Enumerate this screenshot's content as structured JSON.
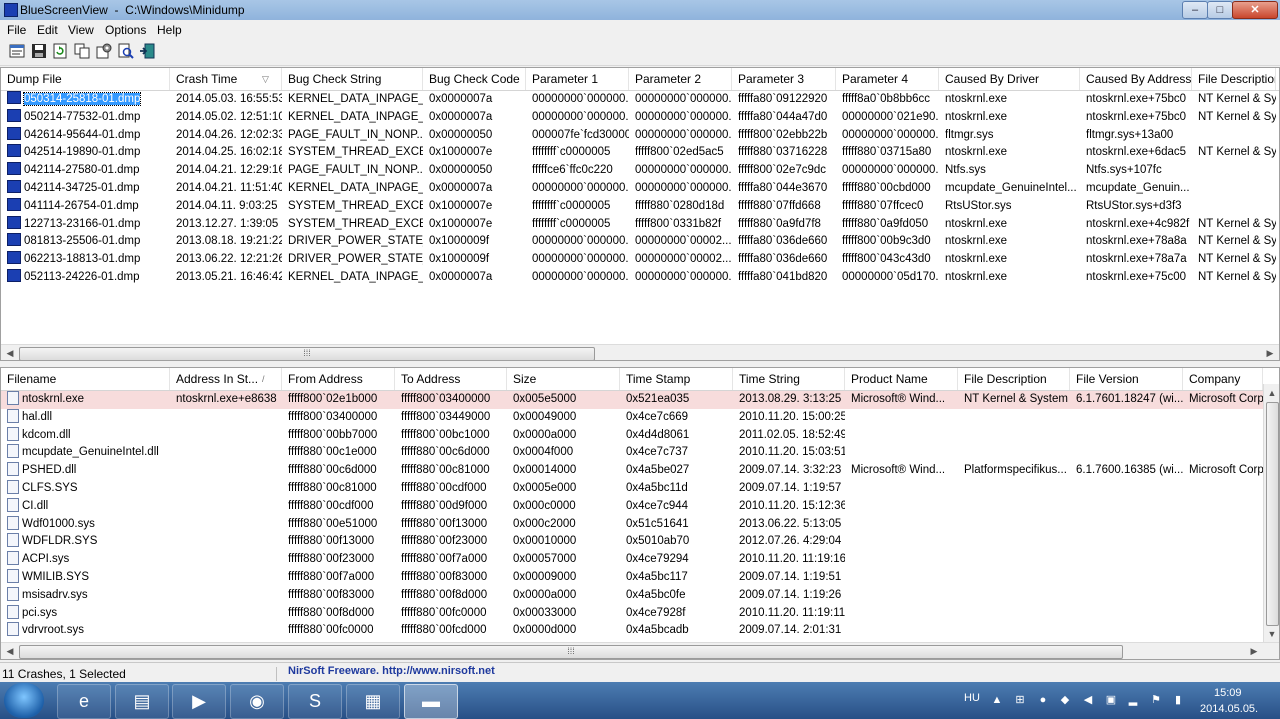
{
  "window": {
    "title": "BlueScreenView  -  C:\\Windows\\Minidump",
    "minimize": "–",
    "maximize": "□",
    "close": "✕"
  },
  "menu": [
    "File",
    "Edit",
    "View",
    "Options",
    "Help"
  ],
  "toolbar_icons": [
    "properties-icon",
    "save-icon",
    "refresh-icon",
    "copy-icon",
    "advanced-options-icon",
    "find-icon",
    "exit-icon"
  ],
  "dumps": {
    "columns": [
      "Dump File",
      "Crash Time",
      "Bug Check String",
      "Bug Check Code",
      "Parameter 1",
      "Parameter 2",
      "Parameter 3",
      "Parameter 4",
      "Caused By Driver",
      "Caused By Address",
      "File Description"
    ],
    "sort_indicator": "▽",
    "rows": [
      [
        "050314-25818-01.dmp",
        "2014.05.03. 16:55:53",
        "KERNEL_DATA_INPAGE_...",
        "0x0000007a",
        "00000000`000000...",
        "00000000`000000...",
        "fffffa80`09122920",
        "fffff8a0`0b8bb6cc",
        "ntoskrnl.exe",
        "ntoskrnl.exe+75bc0",
        "NT Kernel & Syst"
      ],
      [
        "050214-77532-01.dmp",
        "2014.05.02. 12:51:10",
        "KERNEL_DATA_INPAGE_...",
        "0x0000007a",
        "00000000`000000...",
        "00000000`000000...",
        "fffffa80`044a47d0",
        "00000000`021e90...",
        "ntoskrnl.exe",
        "ntoskrnl.exe+75bc0",
        "NT Kernel & Syst"
      ],
      [
        "042614-95644-01.dmp",
        "2014.04.26. 12:02:33",
        "PAGE_FAULT_IN_NONP...",
        "0x00000050",
        "000007fe`fcd30000",
        "00000000`000000...",
        "fffff800`02ebb22b",
        "00000000`000000...",
        "fltmgr.sys",
        "fltmgr.sys+13a00",
        ""
      ],
      [
        "042514-19890-01.dmp",
        "2014.04.25. 16:02:18",
        "SYSTEM_THREAD_EXCE...",
        "0x1000007e",
        "ffffffff`c0000005",
        "fffff800`02ed5ac5",
        "fffff880`03716228",
        "fffff880`03715a80",
        "ntoskrnl.exe",
        "ntoskrnl.exe+6dac5",
        "NT Kernel & Syst"
      ],
      [
        "042114-27580-01.dmp",
        "2014.04.21. 12:29:16",
        "PAGE_FAULT_IN_NONP...",
        "0x00000050",
        "fffffce6`ffc0c220",
        "00000000`000000...",
        "fffff800`02e7c9dc",
        "00000000`000000...",
        "Ntfs.sys",
        "Ntfs.sys+107fc",
        ""
      ],
      [
        "042114-34725-01.dmp",
        "2014.04.21. 11:51:40",
        "KERNEL_DATA_INPAGE_...",
        "0x0000007a",
        "00000000`000000...",
        "00000000`000000...",
        "fffffa80`044e3670",
        "fffff880`00cbd000",
        "mcupdate_GenuineIntel...",
        "mcupdate_Genuin...",
        ""
      ],
      [
        "041114-26754-01.dmp",
        "2014.04.11. 9:03:25",
        "SYSTEM_THREAD_EXCE...",
        "0x1000007e",
        "ffffffff`c0000005",
        "fffff880`0280d18d",
        "fffff880`07ffd668",
        "fffff880`07ffcec0",
        "RtsUStor.sys",
        "RtsUStor.sys+d3f3",
        ""
      ],
      [
        "122713-23166-01.dmp",
        "2013.12.27. 1:39:05",
        "SYSTEM_THREAD_EXCE...",
        "0x1000007e",
        "ffffffff`c0000005",
        "fffff800`0331b82f",
        "fffff880`0a9fd7f8",
        "fffff880`0a9fd050",
        "ntoskrnl.exe",
        "ntoskrnl.exe+4c982f",
        "NT Kernel & Syst"
      ],
      [
        "081813-25506-01.dmp",
        "2013.08.18. 19:21:22",
        "DRIVER_POWER_STATE_...",
        "0x1000009f",
        "00000000`000000...",
        "00000000`00002...",
        "fffffa80`036de660",
        "fffff800`00b9c3d0",
        "ntoskrnl.exe",
        "ntoskrnl.exe+78a8a",
        "NT Kernel & Syst"
      ],
      [
        "062213-18813-01.dmp",
        "2013.06.22. 12:21:26",
        "DRIVER_POWER_STATE_...",
        "0x1000009f",
        "00000000`000000...",
        "00000000`00002...",
        "fffffa80`036de660",
        "fffff800`043c43d0",
        "ntoskrnl.exe",
        "ntoskrnl.exe+78a7a",
        "NT Kernel & Syst"
      ],
      [
        "052113-24226-01.dmp",
        "2013.05.21. 16:46:42",
        "KERNEL_DATA_INPAGE_...",
        "0x0000007a",
        "00000000`000000...",
        "00000000`000000...",
        "fffffa80`041bd820",
        "00000000`05d170...",
        "ntoskrnl.exe",
        "ntoskrnl.exe+75c00",
        "NT Kernel & Syst"
      ]
    ]
  },
  "drivers": {
    "columns": [
      "Filename",
      "Address In St...",
      "From Address",
      "To Address",
      "Size",
      "Time Stamp",
      "Time String",
      "Product Name",
      "File Description",
      "File Version",
      "Company"
    ],
    "sort_indicator": "/",
    "rows": [
      [
        "ntoskrnl.exe",
        "ntoskrnl.exe+e8638",
        "fffff800`02e1b000",
        "fffff800`03400000",
        "0x005e5000",
        "0x521ea035",
        "2013.08.29. 3:13:25",
        "Microsoft® Wind...",
        "NT Kernel & System",
        "6.1.7601.18247 (wi...",
        "Microsoft Corp"
      ],
      [
        "hal.dll",
        "",
        "fffff800`03400000",
        "fffff800`03449000",
        "0x00049000",
        "0x4ce7c669",
        "2010.11.20. 15:00:25",
        "",
        "",
        "",
        ""
      ],
      [
        "kdcom.dll",
        "",
        "fffff800`00bb7000",
        "fffff800`00bc1000",
        "0x0000a000",
        "0x4d4d8061",
        "2011.02.05. 18:52:49",
        "",
        "",
        "",
        ""
      ],
      [
        "mcupdate_GenuineIntel.dll",
        "",
        "fffff880`00c1e000",
        "fffff880`00c6d000",
        "0x0004f000",
        "0x4ce7c737",
        "2010.11.20. 15:03:51",
        "",
        "",
        "",
        ""
      ],
      [
        "PSHED.dll",
        "",
        "fffff880`00c6d000",
        "fffff880`00c81000",
        "0x00014000",
        "0x4a5be027",
        "2009.07.14. 3:32:23",
        "Microsoft® Wind...",
        "Platformspecifikus...",
        "6.1.7600.16385 (wi...",
        "Microsoft Corp"
      ],
      [
        "CLFS.SYS",
        "",
        "fffff880`00c81000",
        "fffff880`00cdf000",
        "0x0005e000",
        "0x4a5bc11d",
        "2009.07.14. 1:19:57",
        "",
        "",
        "",
        ""
      ],
      [
        "CI.dll",
        "",
        "fffff880`00cdf000",
        "fffff880`00d9f000",
        "0x000c0000",
        "0x4ce7c944",
        "2010.11.20. 15:12:36",
        "",
        "",
        "",
        ""
      ],
      [
        "Wdf01000.sys",
        "",
        "fffff880`00e51000",
        "fffff880`00f13000",
        "0x000c2000",
        "0x51c51641",
        "2013.06.22. 5:13:05",
        "",
        "",
        "",
        ""
      ],
      [
        "WDFLDR.SYS",
        "",
        "fffff880`00f13000",
        "fffff880`00f23000",
        "0x00010000",
        "0x5010ab70",
        "2012.07.26. 4:29:04",
        "",
        "",
        "",
        ""
      ],
      [
        "ACPI.sys",
        "",
        "fffff880`00f23000",
        "fffff880`00f7a000",
        "0x00057000",
        "0x4ce79294",
        "2010.11.20. 11:19:16",
        "",
        "",
        "",
        ""
      ],
      [
        "WMILIB.SYS",
        "",
        "fffff880`00f7a000",
        "fffff880`00f83000",
        "0x00009000",
        "0x4a5bc117",
        "2009.07.14. 1:19:51",
        "",
        "",
        "",
        ""
      ],
      [
        "msisadrv.sys",
        "",
        "fffff880`00f83000",
        "fffff880`00f8d000",
        "0x0000a000",
        "0x4a5bc0fe",
        "2009.07.14. 1:19:26",
        "",
        "",
        "",
        ""
      ],
      [
        "pci.sys",
        "",
        "fffff880`00f8d000",
        "fffff880`00fc0000",
        "0x00033000",
        "0x4ce7928f",
        "2010.11.20. 11:19:11",
        "",
        "",
        "",
        ""
      ],
      [
        "vdrvroot.sys",
        "",
        "fffff880`00fc0000",
        "fffff880`00fcd000",
        "0x0000d000",
        "0x4a5bcadb",
        "2009.07.14. 2:01:31",
        "",
        "",
        "",
        ""
      ]
    ]
  },
  "status": {
    "left": "11 Crashes, 1 Selected",
    "link": "NirSoft Freeware.  http://www.nirsoft.net"
  },
  "taskbar": {
    "apps": [
      "internet-explorer",
      "file-explorer",
      "media-player",
      "chrome",
      "skype",
      "winrar",
      "bluescreenview"
    ],
    "language": "HU",
    "time": "15:09",
    "date": "2014.05.05."
  }
}
